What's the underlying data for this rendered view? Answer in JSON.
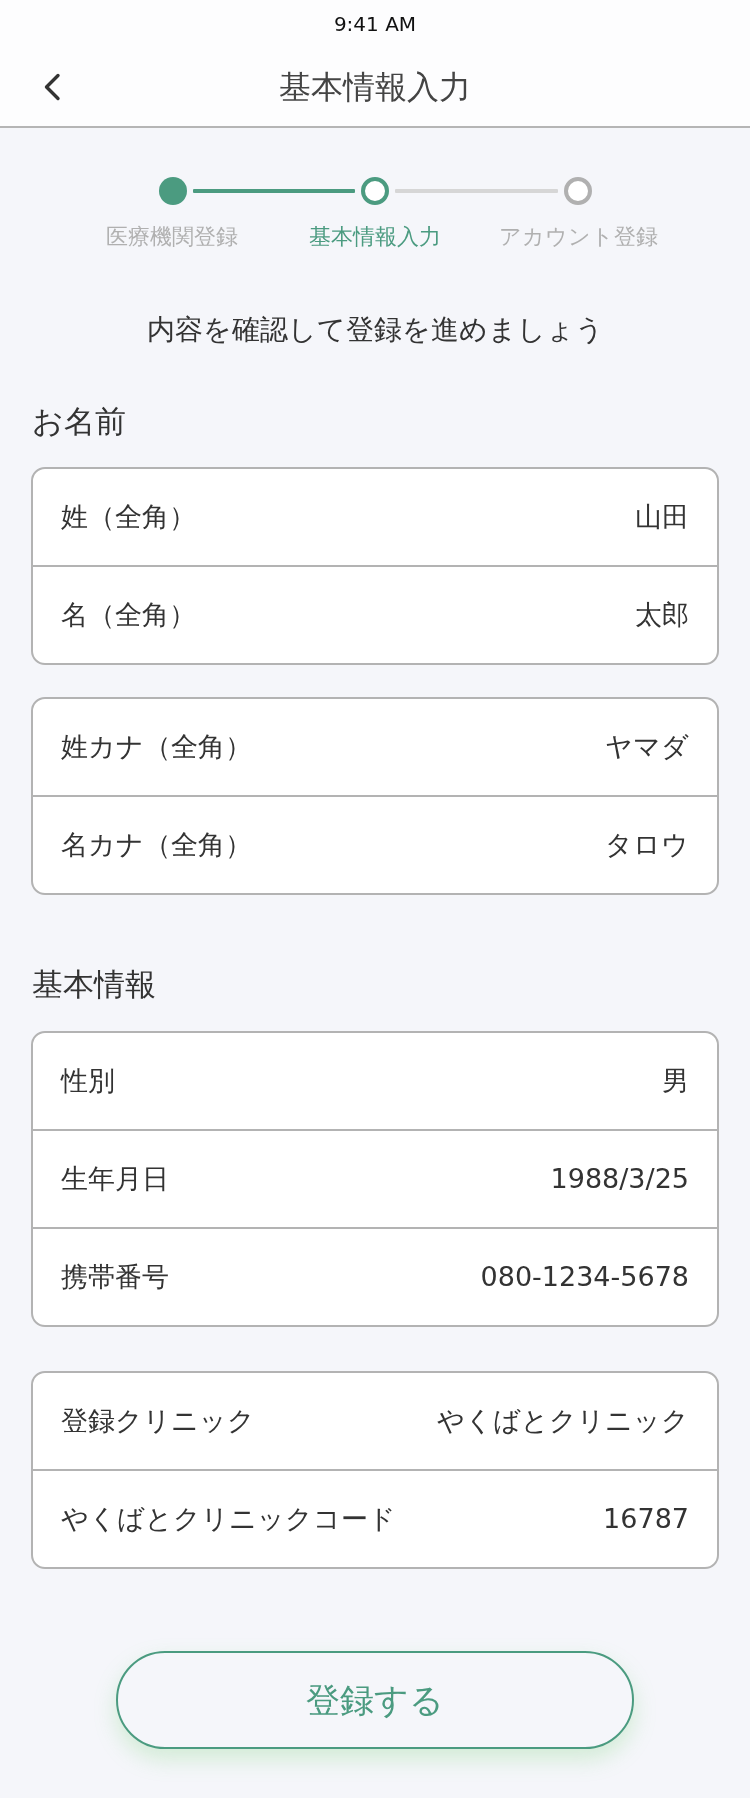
{
  "status_bar": {
    "time": "9:41 AM"
  },
  "header": {
    "title": "基本情報入力"
  },
  "stepper": {
    "steps": [
      {
        "label": "医療機関登録",
        "completed": true,
        "selected": false
      },
      {
        "label": "基本情報入力",
        "completed": false,
        "selected": true
      },
      {
        "label": "アカウント登録",
        "completed": false,
        "selected": false
      }
    ]
  },
  "instruction": "内容を確認して登録を進めましょう",
  "sections": [
    {
      "title": "お名前",
      "cards": [
        {
          "rows": [
            {
              "label": "姓（全角）",
              "value": "山田"
            },
            {
              "label": "名（全角）",
              "value": "太郎"
            }
          ]
        },
        {
          "rows": [
            {
              "label": "姓カナ（全角）",
              "value": "ヤマダ"
            },
            {
              "label": "名カナ（全角）",
              "value": "タロウ"
            }
          ]
        }
      ]
    },
    {
      "title": "基本情報",
      "cards": [
        {
          "rows": [
            {
              "label": "性別",
              "value": "男"
            },
            {
              "label": "生年月日",
              "value": "1988/3/25"
            },
            {
              "label": "携帯番号",
              "value": "080-1234-5678"
            }
          ]
        },
        {
          "rows": [
            {
              "label": "登録クリニック",
              "value": "やくばとクリニック"
            },
            {
              "label": "やくばとクリニックコード",
              "value": "16787"
            }
          ]
        }
      ]
    }
  ],
  "submit_button": {
    "label": "登録する"
  }
}
